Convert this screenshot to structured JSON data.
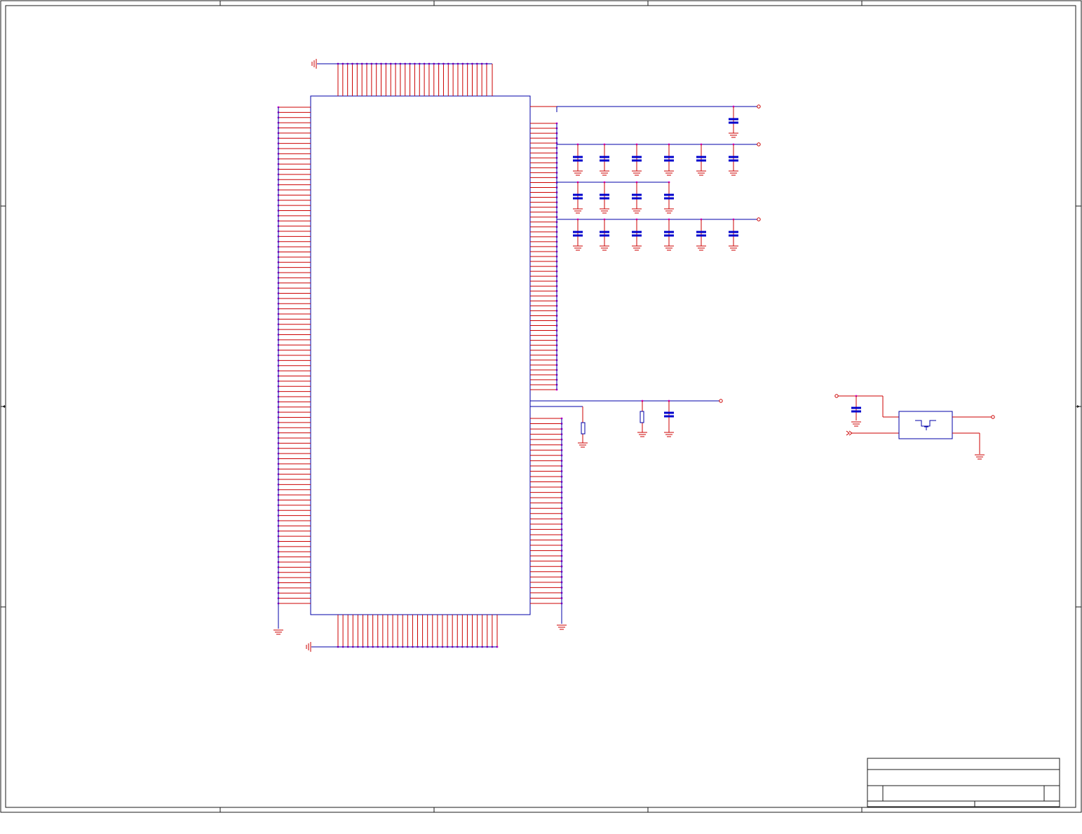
{
  "title": "",
  "colors": {
    "background": "#ffffff",
    "frame": "#1a1a1a",
    "wire_red": "#cc0000",
    "pin_magenta": "#cc00cc",
    "component_blue": "#0000aa",
    "capacitor_blue": "#0000cc",
    "ground_red": "#cc0000"
  },
  "component_counts": {
    "ic_left_pins": 97,
    "ic_top_pins": 32,
    "ic_bottom_pins": 33,
    "ic_right_upper_pins": 55,
    "ic_right_lower_pins": 36,
    "decoupling_capacitor_rows": [
      1,
      6,
      4,
      6
    ]
  },
  "title_block": {
    "rows": 4,
    "cells": [
      "",
      "",
      "",
      ""
    ]
  }
}
